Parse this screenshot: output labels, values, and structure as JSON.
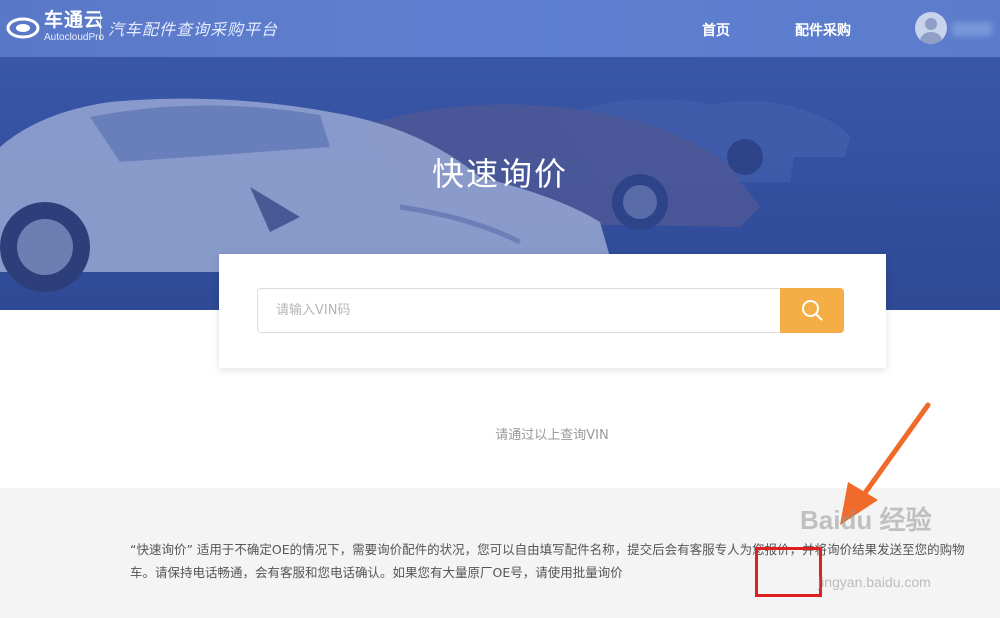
{
  "header": {
    "logo_cn": "车通云",
    "logo_en": "AutocloudPro",
    "slogan": "汽车配件查询采购平台",
    "nav": [
      {
        "label": "首页"
      },
      {
        "label": "配件采购"
      }
    ]
  },
  "hero": {
    "title": "快速询价"
  },
  "search": {
    "placeholder": "请输入VIN码"
  },
  "hint": "请通过以上查询VIN",
  "description": {
    "text_before": "“快速询价” 适用于不确定OE的情况下，需要询价配件的状况，您可以自由填写配件名称，提交后会有客服专人为您报价，并将询价结果发送至您的购物车。请保持电话畅通，会有客服和您电话确认。如果您有大量原厂OE号，请使用",
    "link": "批量询价"
  },
  "watermark": {
    "brand": "Baidu 经验",
    "url": "jingyan.baidu.com"
  },
  "colors": {
    "header": "#5b7bcb",
    "hero": "#324d9a",
    "search_button": "#f5ae45",
    "annotation": "#e02020"
  }
}
